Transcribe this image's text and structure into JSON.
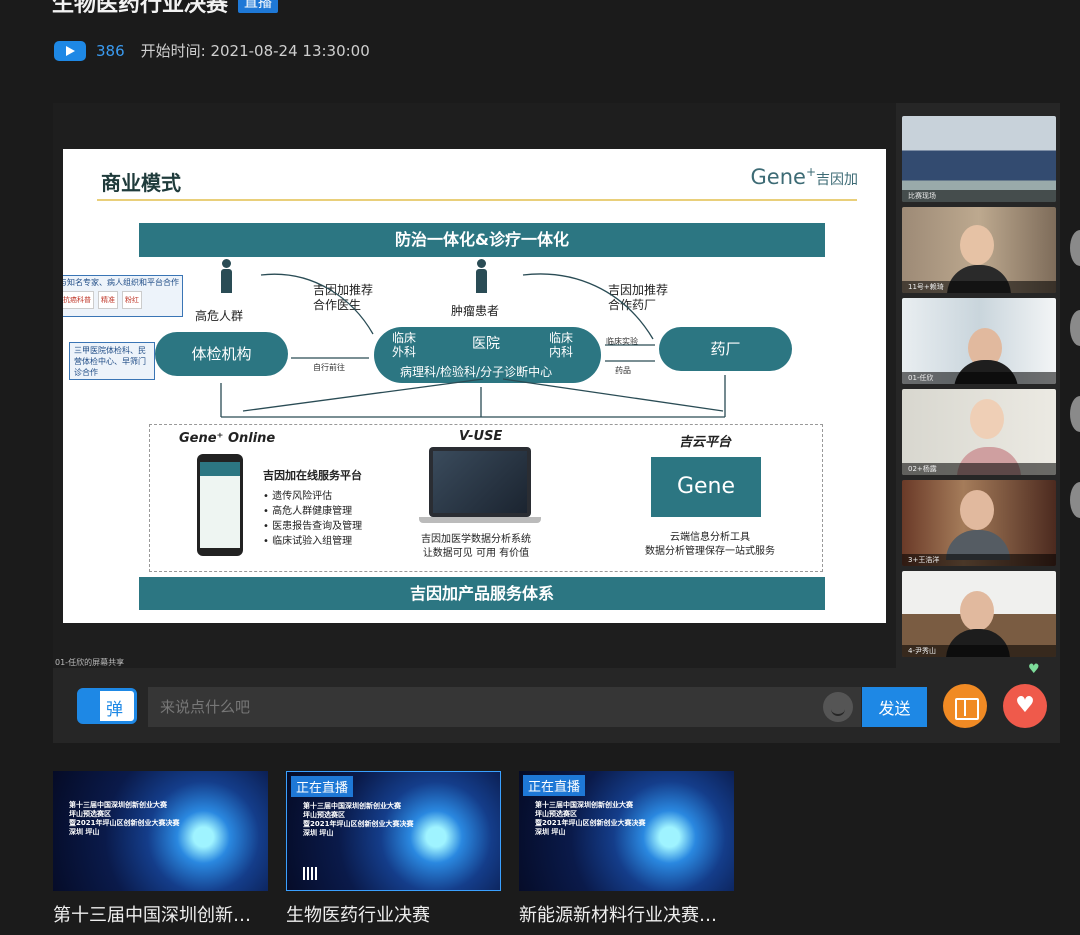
{
  "header": {
    "title": "生物医药行业决赛",
    "live_badge": "直播",
    "view_count": "386",
    "start_time": "开始时间: 2021-08-24 13:30:00"
  },
  "slide": {
    "heading": "商业模式",
    "logo": "Gene",
    "logo_cn": "吉因加",
    "band_top": "防治一体化&诊疗一体化",
    "band_bottom": "吉因加产品服务体系",
    "partners_caption": "与知名专家、病人组织和平台合作",
    "partner_logos": [
      "抗癌科普",
      "精准",
      "粉红"
    ],
    "hospitals_note": "三甲医院体检科、民营体检中心、早筛门诊合作",
    "high_risk": "高危人群",
    "tumor_patients": "肿瘤患者",
    "recommend_doctor": "吉因加推荐\n合作医生",
    "recommend_pharma": "吉因加推荐\n合作药厂",
    "checkup_org": "体检机构",
    "hospital": "医院",
    "clinical_surgery": "临床\n外科",
    "clinical_internal": "临床\n内科",
    "pathology": "病理科/检验科/分子诊断中心",
    "pharma": "药厂",
    "self_go": "自行前往",
    "clinical_trial": "临床实验",
    "drugs": "药品",
    "online_title": "Gene⁺ Online",
    "online_subtitle": "吉因加在线服务平台",
    "online_items": [
      "遗传风险评估",
      "高危人群健康管理",
      "医患报告查询及管理",
      "临床试验入组管理"
    ],
    "vuse_title": "V-USE",
    "vuse_desc": "吉因加医学数据分析系统\n让数据可见 可用 有价值",
    "cloud_title": "吉云平台",
    "cloud_logo": "Gene",
    "cloud_desc": "云端信息分析工具\n数据分析管理保存一站式服务"
  },
  "share_label": "01-任欣的屏幕共享",
  "participants": [
    "比赛现场",
    "11号+赖琦",
    "01-任欣",
    "02+杨露",
    "3+王浩洋",
    "4-尹秀山"
  ],
  "chat": {
    "danmaku_label": "弹",
    "placeholder": "来说点什么吧",
    "send_label": "发送",
    "like_glyph": "♥",
    "mini_heart": "♥"
  },
  "recommendations": [
    {
      "title": "第十三届中国深圳创新…",
      "live_tag": "",
      "active": false
    },
    {
      "title": "生物医药行业决赛",
      "live_tag": "正在直播",
      "active": true
    },
    {
      "title": "新能源新材料行业决赛…",
      "live_tag": "正在直播",
      "active": false
    }
  ],
  "rec_poster_lines": [
    "第十三届中国深圳创新创业大赛",
    "坪山预选赛区",
    "暨2021年坪山区创新创业大赛决赛",
    "深圳 坪山"
  ],
  "colors": {
    "accent": "#1e88e5",
    "slide_teal": "#2c7682",
    "like": "#ef5a4b",
    "gift": "#f08a24"
  }
}
